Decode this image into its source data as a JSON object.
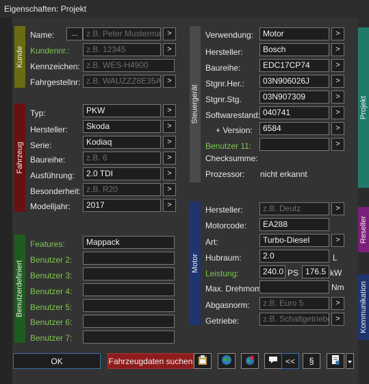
{
  "window": {
    "title": "Eigenschaften: Projekt"
  },
  "colors": {
    "kunde": "#6b6b12",
    "fahrzeug": "#6b1010",
    "benutzer": "#1f5c1f",
    "steuergeraet": "#4a4a4a",
    "motor": "#1e3570",
    "projekt_tab": "#1f7a6a",
    "reseller_tab": "#7a1f7a",
    "kommunikation_tab": "#1e3570"
  },
  "groups": {
    "kunde": "Kunde",
    "fahrzeug": "Fahrzeug",
    "benutzer": "Benutzerdefiniert",
    "steuergeraet": "Steuergerät",
    "motor": "Motor"
  },
  "tabs": {
    "projekt": "Projekt",
    "reseller": "Reseller",
    "kommunikation": "Kommunikation"
  },
  "kunde": {
    "name": {
      "label": "Name:",
      "placeholder": "z.B. Peter Mustermann"
    },
    "kundennr": {
      "label": "Kundennr.:",
      "placeholder": "z.B. 12345"
    },
    "kennzeichen": {
      "label": "Kennzeichen:",
      "placeholder": "z.B. WES-H4900"
    },
    "fahrgestellnr": {
      "label": "Fahrgestellnr:",
      "placeholder": "z.B. WAUZZZ8E35A235"
    },
    "dots": "..."
  },
  "fahrzeug": {
    "typ": {
      "label": "Typ:",
      "value": "PKW"
    },
    "hersteller": {
      "label": "Hersteller:",
      "value": "Skoda"
    },
    "serie": {
      "label": "Serie:",
      "value": "Kodiaq"
    },
    "baureihe": {
      "label": "Baureihe:",
      "placeholder": "z.B. 6"
    },
    "ausfuehrung": {
      "label": "Ausführung:",
      "value": "2.0 TDI"
    },
    "besonderheit": {
      "label": "Besonderheit:",
      "placeholder": "z.B. R20"
    },
    "modelljahr": {
      "label": "Modelljahr:",
      "value": "2017"
    }
  },
  "benutzer": {
    "features": {
      "label": "Features:",
      "value": "Mappack"
    },
    "b2": {
      "label": "Benutzer 2:"
    },
    "b3": {
      "label": "Benutzer 3:"
    },
    "b4": {
      "label": "Benutzer 4:"
    },
    "b5": {
      "label": "Benutzer 5:"
    },
    "b6": {
      "label": "Benutzer 6:"
    },
    "b7": {
      "label": "Benutzer 7:"
    }
  },
  "steuergeraet": {
    "verwendung": {
      "label": "Verwendung:",
      "value": "Motor"
    },
    "hersteller": {
      "label": "Hersteller:",
      "value": "Bosch"
    },
    "baureihe": {
      "label": "Baureihe:",
      "value": "EDC17CP74"
    },
    "stgnr_her": {
      "label": "Stgnr.Her.:",
      "value": "03N906026J"
    },
    "stgnr_stg": {
      "label": "Stgnr.Stg.",
      "value": "03N907309"
    },
    "softwarestand": {
      "label": "Softwarestand:",
      "value": "040741"
    },
    "version": {
      "label": "+ Version:",
      "value": "6584"
    },
    "benutzer11": {
      "label": "Benutzer 11:"
    },
    "checksumme": {
      "label": "Checksumme:"
    },
    "prozessor": {
      "label": "Prozessor:",
      "value": "nicht erkannt"
    }
  },
  "motor": {
    "hersteller": {
      "label": "Hersteller:",
      "placeholder": "z.B. Deutz"
    },
    "motorcode": {
      "label": "Motorcode:",
      "value": "EA288"
    },
    "art": {
      "label": "Art:",
      "value": "Turbo-Diesel"
    },
    "hubraum": {
      "label": "Hubraum:",
      "value": "2.0",
      "unit": "L"
    },
    "leistung": {
      "label": "Leistung:",
      "ps": "240.0",
      "ps_unit": "PS",
      "kw": "176.5",
      "kw_unit": "kW"
    },
    "drehmom": {
      "label": "Max. Drehmom.",
      "unit": "Nm"
    },
    "abgasnorm": {
      "label": "Abgasnorm:",
      "placeholder": "z.B. Euro 5"
    },
    "getriebe": {
      "label": "Getriebe:",
      "placeholder": "z.B. Schaltgetriebe"
    }
  },
  "arrow": ">",
  "footer": {
    "ok": "OK",
    "fahrzeugdaten": "Fahrzeugdaten suchen",
    "collapse": "<<",
    "paragraph": "§"
  }
}
